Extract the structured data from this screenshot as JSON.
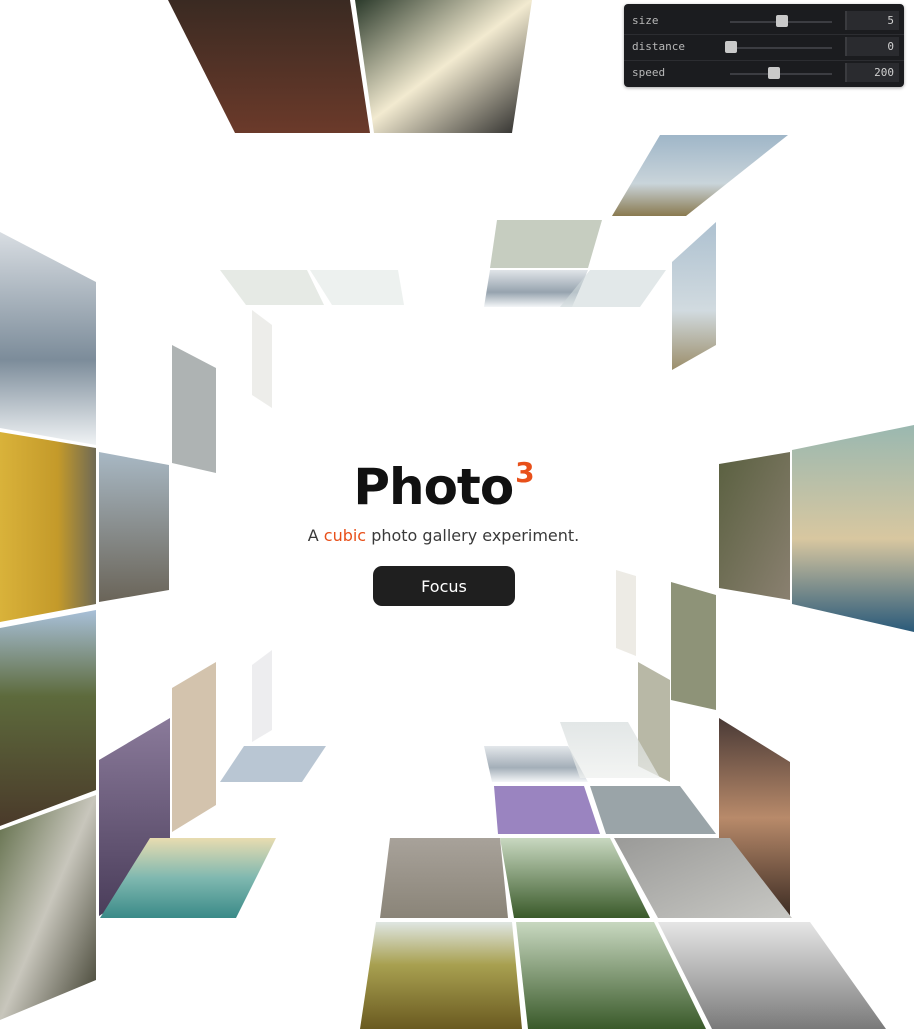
{
  "controls": [
    {
      "label": "size",
      "value": "5",
      "level": 0.5
    },
    {
      "label": "distance",
      "value": "0",
      "level": 0.0
    },
    {
      "label": "speed",
      "value": "200",
      "level": 0.42
    }
  ],
  "hero": {
    "title": "Photo",
    "superscript": "3",
    "subtitle_before": "A ",
    "subtitle_accent": "cubic",
    "subtitle_after": " photo gallery experiment.",
    "button_label": "Focus"
  },
  "colors": {
    "accent": "#e8501a",
    "button": "#1f1f1f",
    "panel": "#1b1c1f"
  }
}
